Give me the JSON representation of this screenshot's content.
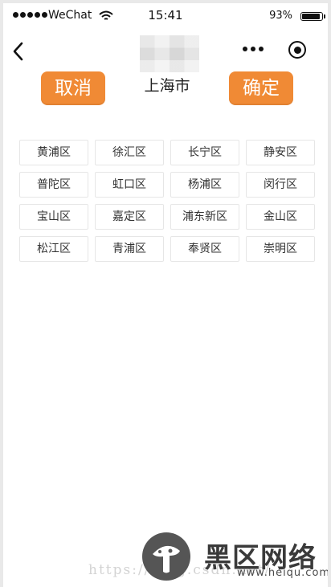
{
  "status_bar": {
    "carrier": "WeChat",
    "time": "15:41",
    "battery": "93%"
  },
  "nav": {
    "back_icon": "chevron-left-icon",
    "more_icon": "more-dots-icon",
    "record_icon": "record-icon"
  },
  "picker": {
    "cancel_label": "取消",
    "title": "上海市",
    "confirm_label": "确定",
    "accent_color": "#f08a35"
  },
  "districts": [
    "黄浦区",
    "徐汇区",
    "长宁区",
    "静安区",
    "普陀区",
    "虹口区",
    "杨浦区",
    "闵行区",
    "宝山区",
    "嘉定区",
    "浦东新区",
    "金山区",
    "松江区",
    "青浦区",
    "奉贤区",
    "崇明区"
  ],
  "watermark": {
    "url_text": "https://blog.csdn.net/",
    "logo_text": "黑区网络",
    "domain": "www.heiqu.com"
  }
}
